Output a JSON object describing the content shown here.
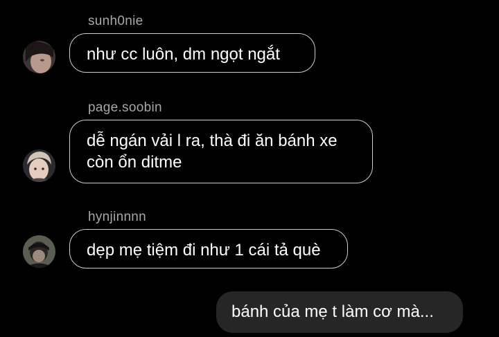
{
  "messages": [
    {
      "sender": "sunh0nie",
      "lines": [
        "như cc luôn, dm ngọt ngắt"
      ],
      "avatar_icon": "user-avatar-icon"
    },
    {
      "sender": "page.soobin",
      "lines": [
        "dễ ngán vải l ra, thà đi ăn bánh xe",
        "còn ổn ditme"
      ],
      "avatar_icon": "user-avatar-icon"
    },
    {
      "sender": "hynjinnnn",
      "lines": [
        "dẹp mẹ tiệm đi như 1 cái tả què"
      ],
      "avatar_icon": "user-avatar-icon"
    }
  ],
  "outgoing": {
    "text": "bánh của mẹ t làm cơ mà..."
  },
  "colors": {
    "background": "#000000",
    "incoming_border": "#cfcfcf",
    "outgoing_bg": "#262626",
    "sender_text": "#a8a8a8"
  }
}
